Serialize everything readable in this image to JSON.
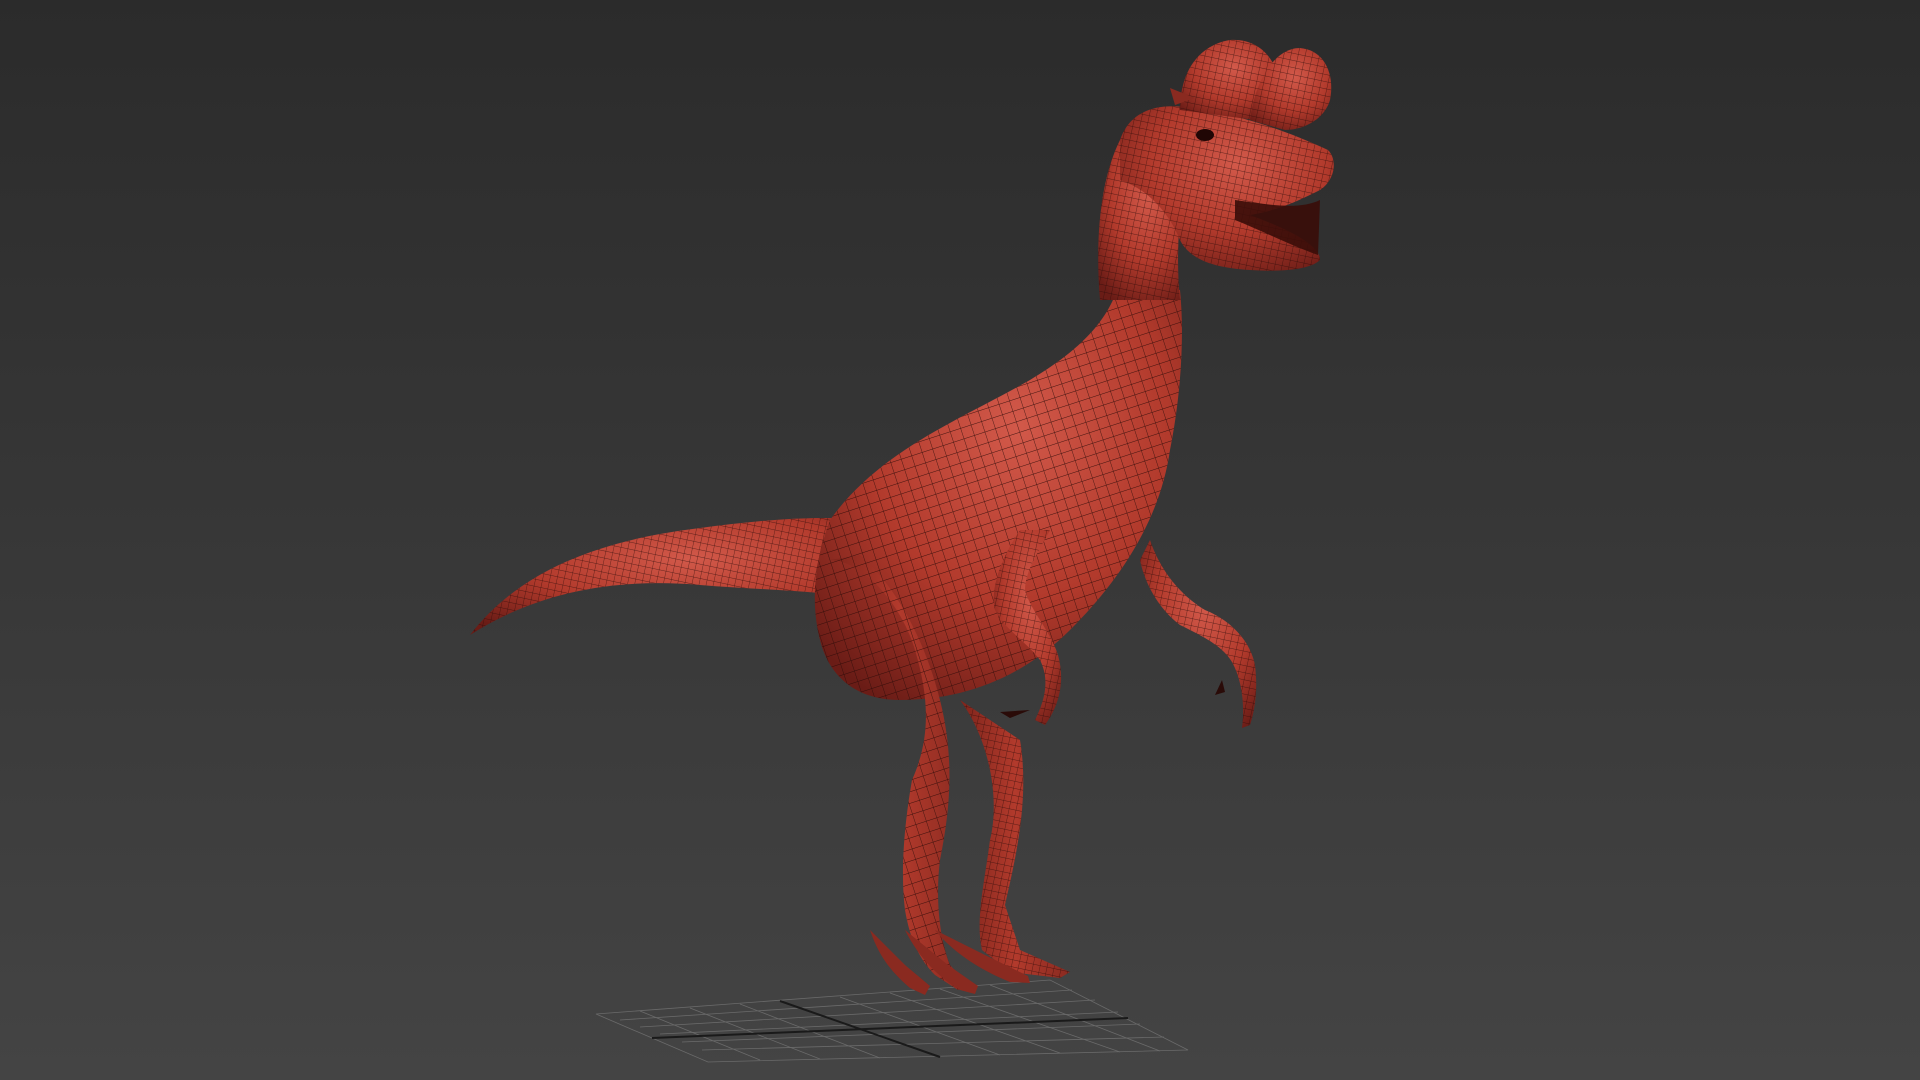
{
  "viewport": {
    "background_top": "#2b2b2b",
    "background_bottom": "#444444"
  },
  "model": {
    "name": "dilophosaurus-wireframe",
    "skin_color": "#b23a2c",
    "skin_highlight": "#d2594a",
    "skin_shadow": "#6a1c16",
    "wire_color": "#2a0b08"
  },
  "grid": {
    "color": "#8a8a8a",
    "axis_color": "#1a1a1a"
  }
}
